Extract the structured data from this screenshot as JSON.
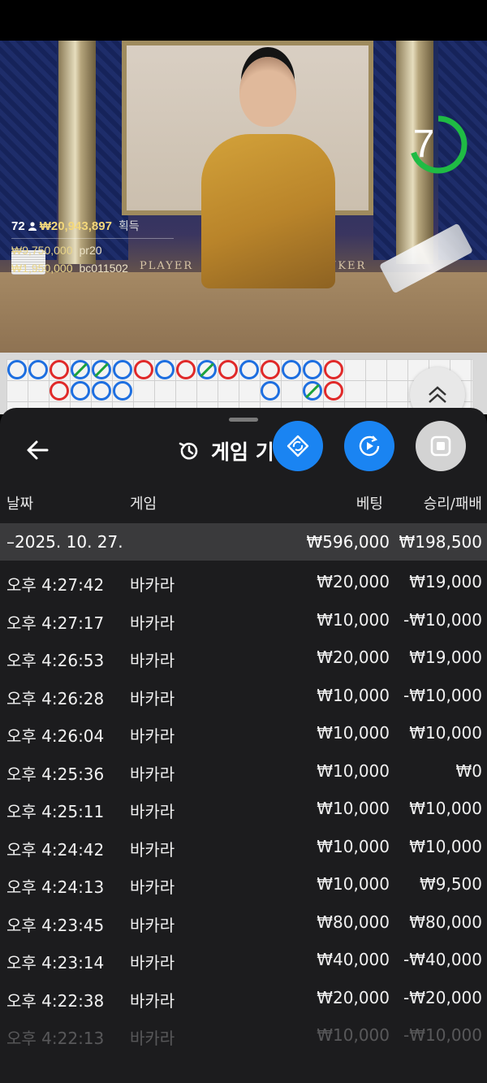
{
  "video": {
    "timer": "7",
    "timer_progress": 0.7,
    "table_labels": [
      "PLAYER",
      "BANKER"
    ],
    "bet_summary": {
      "players": "72",
      "total_won": "₩20,943,897",
      "won_label": "획득",
      "rows": [
        {
          "amount": "₩9,750,000",
          "user": "pr20"
        },
        {
          "amount": "₩1,950,000",
          "user": "bc011502"
        }
      ]
    }
  },
  "roadmap": {
    "bead_colors": {
      "player": "#1e6fe0",
      "banker": "#e02a2a",
      "tie": "#1ea33c"
    }
  },
  "panel": {
    "title": "게임 기록",
    "columns": {
      "date": "날짜",
      "game": "게임",
      "bet": "베팅",
      "result": "승리/패배"
    },
    "date_group": {
      "label": "–2025. 10. 27.",
      "bet": "₩596,000",
      "result": "₩198,500"
    },
    "rows": [
      {
        "time": "오후 4:27:42",
        "game": "바카라",
        "bet": "₩20,000",
        "result": "₩19,000"
      },
      {
        "time": "오후 4:27:17",
        "game": "바카라",
        "bet": "₩10,000",
        "result": "-₩10,000"
      },
      {
        "time": "오후 4:26:53",
        "game": "바카라",
        "bet": "₩20,000",
        "result": "₩19,000"
      },
      {
        "time": "오후 4:26:28",
        "game": "바카라",
        "bet": "₩10,000",
        "result": "-₩10,000"
      },
      {
        "time": "오후 4:26:04",
        "game": "바카라",
        "bet": "₩10,000",
        "result": "₩10,000"
      },
      {
        "time": "오후 4:25:36",
        "game": "바카라",
        "bet": "₩10,000",
        "result": "₩0"
      },
      {
        "time": "오후 4:25:11",
        "game": "바카라",
        "bet": "₩10,000",
        "result": "₩10,000"
      },
      {
        "time": "오후 4:24:42",
        "game": "바카라",
        "bet": "₩10,000",
        "result": "₩10,000"
      },
      {
        "time": "오후 4:24:13",
        "game": "바카라",
        "bet": "₩10,000",
        "result": "₩9,500"
      },
      {
        "time": "오후 4:23:45",
        "game": "바카라",
        "bet": "₩80,000",
        "result": "₩80,000"
      },
      {
        "time": "오후 4:23:14",
        "game": "바카라",
        "bet": "₩40,000",
        "result": "-₩40,000"
      },
      {
        "time": "오후 4:22:38",
        "game": "바카라",
        "bet": "₩20,000",
        "result": "-₩20,000"
      },
      {
        "time": "오후 4:22:13",
        "game": "바카라",
        "bet": "₩10,000",
        "result": "-₩10,000"
      }
    ]
  }
}
